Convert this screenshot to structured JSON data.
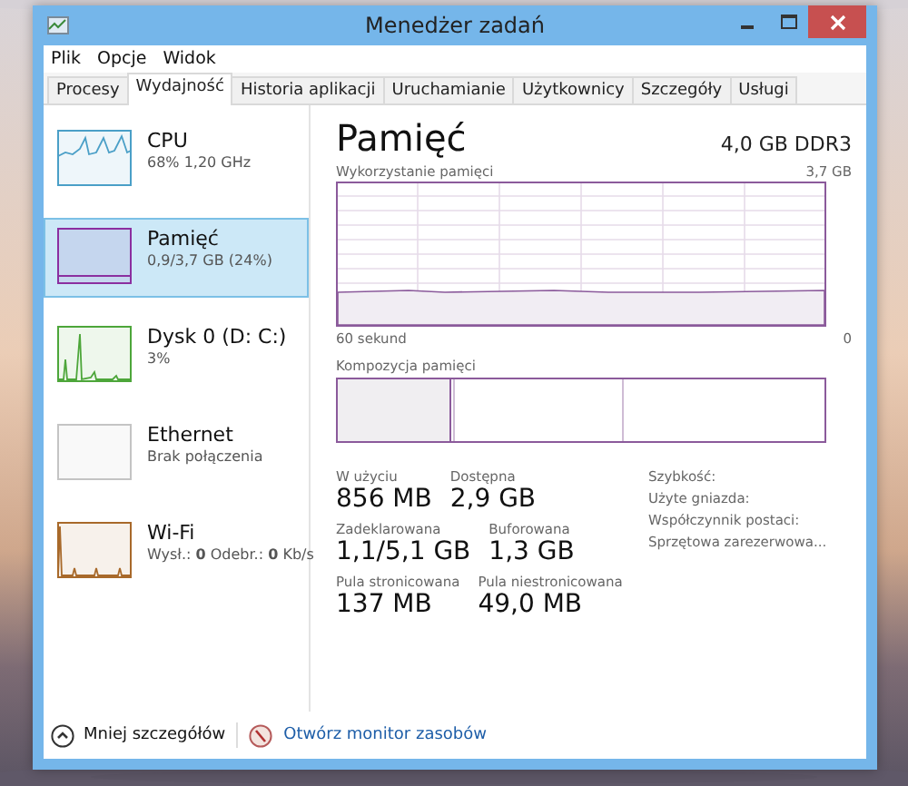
{
  "window": {
    "title": "Menedżer zadań"
  },
  "menu": [
    "Plik",
    "Opcje",
    "Widok"
  ],
  "tabs": [
    {
      "label": "Procesy",
      "selected": false
    },
    {
      "label": "Wydajność",
      "selected": true
    },
    {
      "label": "Historia aplikacji",
      "selected": false
    },
    {
      "label": "Uruchamianie",
      "selected": false
    },
    {
      "label": "Użytkownicy",
      "selected": false
    },
    {
      "label": "Szczegóły",
      "selected": false
    },
    {
      "label": "Usługi",
      "selected": false
    }
  ],
  "sidebar": {
    "items": [
      {
        "name": "CPU",
        "detail": "68% 1,20 GHz",
        "color": "#4a9fc7",
        "selected": false
      },
      {
        "name": "Pamięć",
        "detail": "0,9/3,7 GB (24%)",
        "color": "#8b2fa0",
        "selected": true
      },
      {
        "name": "Dysk 0 (D: C:)",
        "detail": "3%",
        "color": "#4da63a",
        "selected": false
      },
      {
        "name": "Ethernet",
        "detail": "Brak połączenia",
        "color": "#c4c4c4",
        "selected": false
      },
      {
        "name": "Wi-Fi",
        "detail": "Wysł.: **0** Odebr.: **0** Kb/s",
        "color": "#a8692a",
        "selected": false
      }
    ]
  },
  "panel": {
    "title": "Pamięć",
    "spec": "4,0 GB DDR3",
    "usage_label": "Wykorzystanie pamięci",
    "usage_max": "3,7 GB",
    "time_start": "60 sekund",
    "time_end": "0",
    "composition_label": "Kompozycja pamięci",
    "stats": [
      [
        {
          "label": "W użyciu",
          "value": "856 MB"
        },
        {
          "label": "Dostępna",
          "value": "2,9 GB"
        }
      ],
      [
        {
          "label": "Zadeklarowana",
          "value": "1,1/5,1 GB"
        },
        {
          "label": "Buforowana",
          "value": "1,3 GB"
        }
      ],
      [
        {
          "label": "Pula stronicowana",
          "value": "137 MB"
        },
        {
          "label": "Pula niestronicowana",
          "value": "49,0 MB"
        }
      ]
    ],
    "properties": [
      "Szybkość:",
      "Użyte gniazda:",
      "Współczynnik postaci:",
      "Sprzętowa zarezerwowa..."
    ]
  },
  "footer": {
    "details_button": "Mniej szczegółów",
    "monitor_link": "Otwórz monitor zasobów"
  }
}
